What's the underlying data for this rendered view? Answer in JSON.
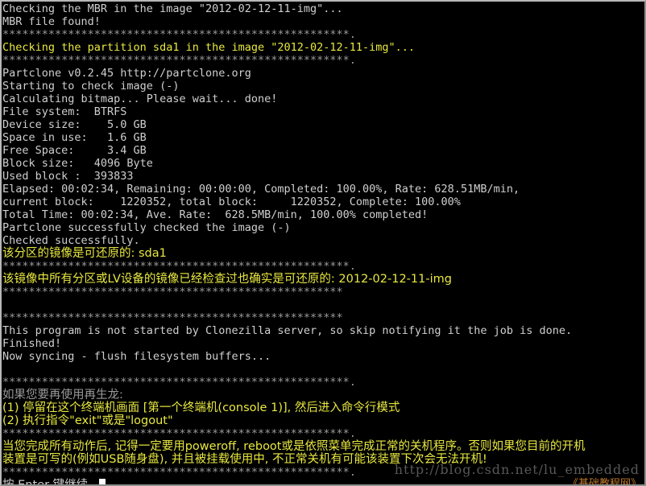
{
  "terminal": {
    "background_color": "#000000",
    "default_text_color": "#cfcfcf",
    "highlight_text_color": "#e8e840",
    "separator_color": "#9a9a9a",
    "cursor_color": "#ffffff",
    "lines": [
      {
        "text": "Checking the MBR in the image \"2012-02-12-11-img\"...",
        "color": "white",
        "cjk": false
      },
      {
        "text": "MBR file found!",
        "color": "white",
        "cjk": false
      },
      {
        "text": "*****************************************************.",
        "color": "gray",
        "cjk": false
      },
      {
        "text": "Checking the partition sda1 in the image \"2012-02-12-11-img\"...",
        "color": "yellow",
        "cjk": false
      },
      {
        "text": "*****************************************************.",
        "color": "gray",
        "cjk": false
      },
      {
        "text": "Partclone v0.2.45 http://partclone.org",
        "color": "white",
        "cjk": false
      },
      {
        "text": "Starting to check image (-)",
        "color": "white",
        "cjk": false
      },
      {
        "text": "Calculating bitmap... Please wait... done!",
        "color": "white",
        "cjk": false
      },
      {
        "text": "File system:  BTRFS",
        "color": "white",
        "cjk": false
      },
      {
        "text": "Device size:    5.0 GB",
        "color": "white",
        "cjk": false
      },
      {
        "text": "Space in use:   1.6 GB",
        "color": "white",
        "cjk": false
      },
      {
        "text": "Free Space:     3.4 GB",
        "color": "white",
        "cjk": false
      },
      {
        "text": "Block size:   4096 Byte",
        "color": "white",
        "cjk": false
      },
      {
        "text": "Used block :  393833",
        "color": "white",
        "cjk": false
      },
      {
        "text": "Elapsed: 00:02:34, Remaining: 00:00:00, Completed: 100.00%, Rate: 628.51MB/min,",
        "color": "white",
        "cjk": false
      },
      {
        "text": "current block:    1220352, total block:     1220352, Complete: 100.00%",
        "color": "white",
        "cjk": false
      },
      {
        "text": "Total Time: 00:02:34, Ave. Rate:  628.5MB/min, 100.00% completed!",
        "color": "white",
        "cjk": false
      },
      {
        "text": "Partclone successfully checked the image (-)",
        "color": "white",
        "cjk": false
      },
      {
        "text": "Checked successfully.",
        "color": "white",
        "cjk": false
      },
      {
        "text": "该分区的镜像是可还原的: sda1",
        "color": "yellow",
        "cjk": true
      },
      {
        "text": "*****************************************************.",
        "color": "gray",
        "cjk": false
      },
      {
        "text": "该镜像中所有分区或LV设备的镜像已经检查过也确实是可还原的: 2012-02-12-11-img",
        "color": "yellow",
        "cjk": true
      },
      {
        "text": "****************************************************",
        "color": "gray",
        "cjk": false
      },
      {
        "text": "",
        "color": "white",
        "cjk": false
      },
      {
        "text": "****************************************************",
        "color": "gray",
        "cjk": false
      },
      {
        "text": "This program is not started by Clonezilla server, so skip notifying it the job is done.",
        "color": "white",
        "cjk": false
      },
      {
        "text": "Finished!",
        "color": "white",
        "cjk": false
      },
      {
        "text": "Now syncing - flush filesystem buffers...",
        "color": "white",
        "cjk": false
      },
      {
        "text": "",
        "color": "white",
        "cjk": false
      },
      {
        "text": "*****************************************************.",
        "color": "gray",
        "cjk": false
      },
      {
        "text": "如果您要再使用再生龙:",
        "color": "gray",
        "cjk": true
      },
      {
        "text": "(1) 停留在这个终端机画面 [第一个终端机(console 1)], 然后进入命令行模式",
        "color": "yellow",
        "cjk": true
      },
      {
        "text": "(2) 执行指令\"exit\"或是\"logout\"",
        "color": "yellow",
        "cjk": true
      },
      {
        "text": "*****************************************************.",
        "color": "gray",
        "cjk": false
      },
      {
        "text": "当您完成所有动作后, 记得一定要用poweroff, reboot或是依照菜单完成正常的关机程序。否则如果您目前的开机",
        "color": "yellow",
        "cjk": true
      },
      {
        "text": "装置是可写的(例如USB随身盘), 并且被挂载使用中, 不正常关机有可能该装置下次会无法开机!",
        "color": "yellow",
        "cjk": true
      },
      {
        "text": "*****************************************************.",
        "color": "gray",
        "cjk": false
      }
    ],
    "prompt": {
      "text": "按 Enter 键继续...",
      "color": "white",
      "cursor": "block"
    }
  },
  "watermark": {
    "url": "http://blog.csdn.net/lu_embedded",
    "brand": "《基础教程网》",
    "url_color": "#585858",
    "brand_color": "#c07a2a"
  }
}
